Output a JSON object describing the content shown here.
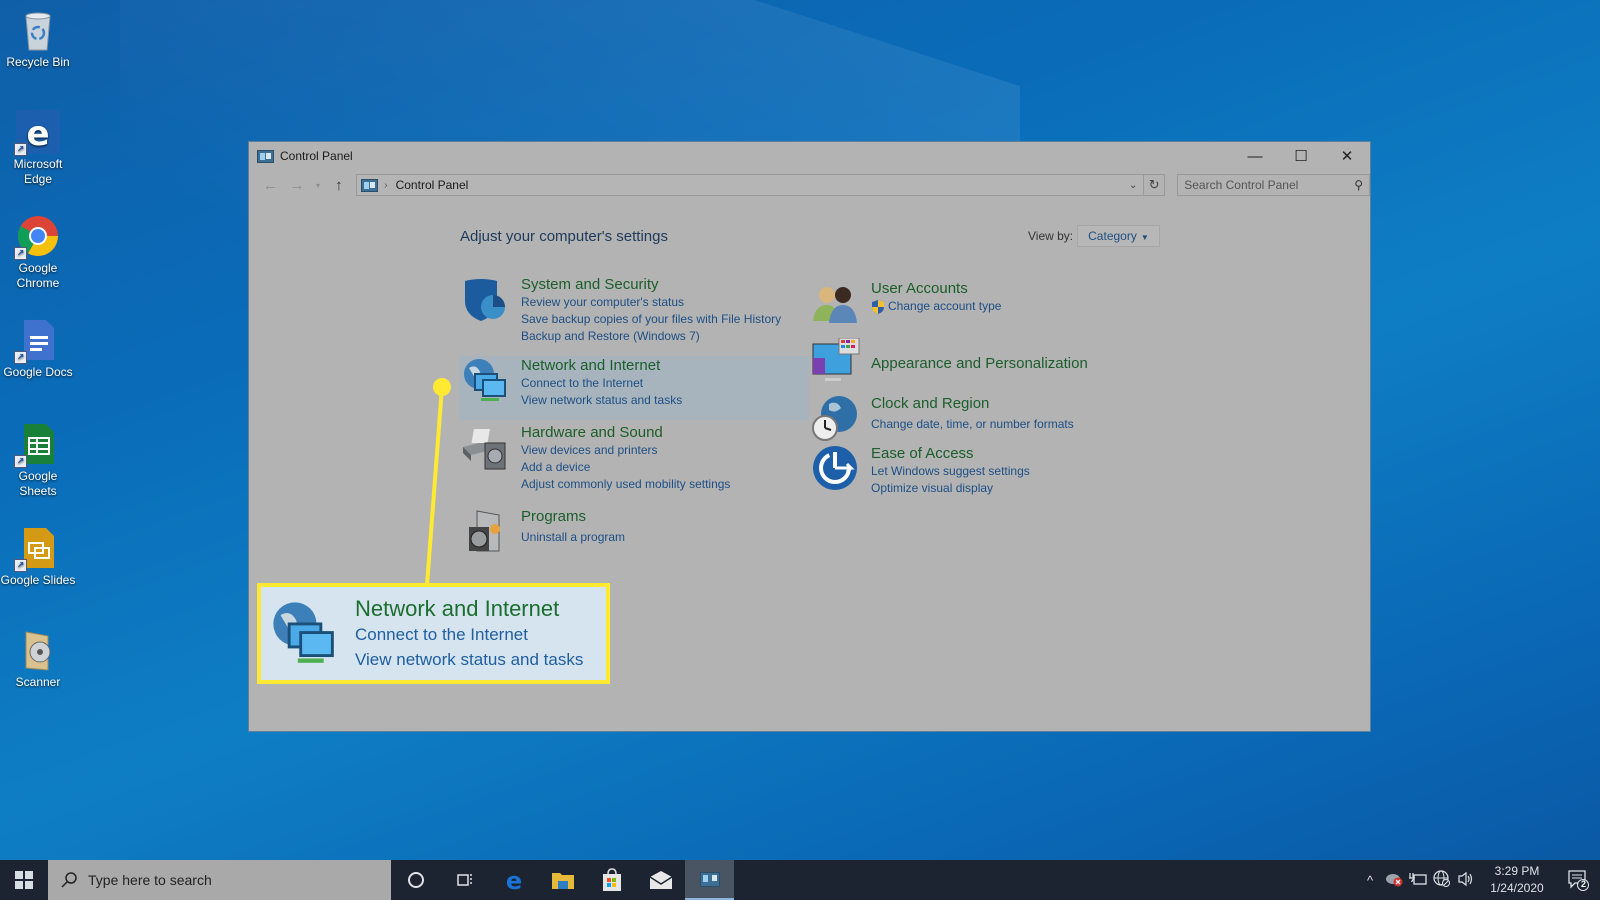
{
  "desktop": {
    "icons": [
      {
        "label": "Recycle Bin",
        "icon": "recycle-bin-icon"
      },
      {
        "label": "Microsoft Edge",
        "icon": "edge-icon"
      },
      {
        "label": "Google Chrome",
        "icon": "chrome-icon"
      },
      {
        "label": "Google Docs",
        "icon": "google-docs-icon"
      },
      {
        "label": "Google Sheets",
        "icon": "google-sheets-icon"
      },
      {
        "label": "Google Slides",
        "icon": "google-slides-icon"
      },
      {
        "label": "Scanner",
        "icon": "scanner-icon"
      }
    ]
  },
  "window": {
    "title": "Control Panel",
    "controls": {
      "minimize": "—",
      "maximize": "☐",
      "close": "✕"
    },
    "nav": {
      "back": "←",
      "forward": "→",
      "recent": "▾",
      "up": "↑"
    },
    "address": {
      "breadcrumb_sep": "›",
      "location": "Control Panel",
      "dropdown": "⌄",
      "refresh": "↻"
    },
    "search": {
      "placeholder": "Search Control Panel",
      "icon": "⚲"
    },
    "heading": "Adjust your computer's settings",
    "view_by": {
      "label": "View by:",
      "selected": "Category",
      "arrow": "▼"
    },
    "categories_left": [
      {
        "title": "System and Security",
        "icon": "shield-icon",
        "links": [
          "Review your computer's status",
          "Save backup copies of your files with File History",
          "Backup and Restore (Windows 7)"
        ]
      },
      {
        "title": "Network and Internet",
        "icon": "network-icon",
        "highlighted": true,
        "links": [
          "Connect to the Internet",
          "View network status and tasks"
        ]
      },
      {
        "title": "Hardware and Sound",
        "icon": "printer-icon",
        "links": [
          "View devices and printers",
          "Add a device",
          "Adjust commonly used mobility settings"
        ]
      },
      {
        "title": "Programs",
        "icon": "programs-icon",
        "links": [
          "Uninstall a program"
        ]
      }
    ],
    "categories_right": [
      {
        "title": "User Accounts",
        "icon": "users-icon",
        "links": [
          "Change account type"
        ]
      },
      {
        "title": "Appearance and Personalization",
        "icon": "appearance-icon",
        "links": []
      },
      {
        "title": "Clock and Region",
        "icon": "clock-globe-icon",
        "links": [
          "Change date, time, or number formats"
        ]
      },
      {
        "title": "Ease of Access",
        "icon": "ease-of-access-icon",
        "links": [
          "Let Windows suggest settings",
          "Optimize visual display"
        ]
      }
    ]
  },
  "callout": {
    "title": "Network and Internet",
    "links": [
      "Connect to the Internet",
      "View network status and tasks"
    ],
    "accent": "#ffe933"
  },
  "taskbar": {
    "search_placeholder": "Type here to search",
    "apps": [
      "cortana",
      "task-view",
      "edge",
      "file-explorer",
      "store",
      "mail",
      "control-panel"
    ],
    "tray": {
      "chevron": "^",
      "clock_time": "3:29 PM",
      "clock_date": "1/24/2020",
      "notification_count": "2"
    }
  }
}
